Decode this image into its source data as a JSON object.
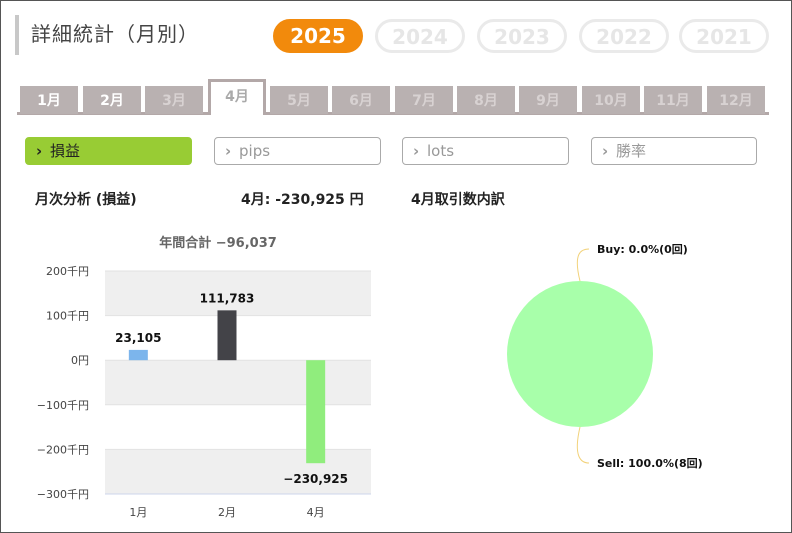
{
  "page": {
    "title": "詳細統計（月別）"
  },
  "years": [
    {
      "label": "2025",
      "active": true
    },
    {
      "label": "2024",
      "active": false
    },
    {
      "label": "2023",
      "active": false
    },
    {
      "label": "2022",
      "active": false
    },
    {
      "label": "2021",
      "active": false
    }
  ],
  "months": [
    {
      "label": "1月",
      "state": "enabled"
    },
    {
      "label": "2月",
      "state": "enabled"
    },
    {
      "label": "3月",
      "state": "disabled"
    },
    {
      "label": "4月",
      "state": "active"
    },
    {
      "label": "5月",
      "state": "disabled"
    },
    {
      "label": "6月",
      "state": "disabled"
    },
    {
      "label": "7月",
      "state": "disabled"
    },
    {
      "label": "8月",
      "state": "disabled"
    },
    {
      "label": "9月",
      "state": "disabled"
    },
    {
      "label": "10月",
      "state": "disabled"
    },
    {
      "label": "11月",
      "state": "disabled"
    },
    {
      "label": "12月",
      "state": "disabled"
    }
  ],
  "metrics": [
    {
      "label": "損益",
      "active": true
    },
    {
      "label": "pips",
      "active": false
    },
    {
      "label": "lots",
      "active": false
    },
    {
      "label": "勝率",
      "active": false
    }
  ],
  "headers": {
    "analysis": "月次分析 (損益)",
    "month_value": "4月:  -230,925 円",
    "breakdown": "4月取引数内訳"
  },
  "chart_data": [
    {
      "type": "bar",
      "title": "年間合計 −96,037",
      "categories": [
        "1月",
        "2月",
        "4月"
      ],
      "values": [
        23105,
        111783,
        -230925
      ],
      "value_labels": [
        "23,105",
        "111,783",
        "−230,925"
      ],
      "colors": [
        "#7cb5ec",
        "#434348",
        "#90ed7d"
      ],
      "ylim": [
        -300000,
        200000
      ],
      "yticks": [
        200000,
        100000,
        0,
        -100000,
        -200000,
        -300000
      ],
      "ytick_labels": [
        "200千円",
        "100千円",
        "0円",
        "−100千円",
        "−200千円",
        "−300千円"
      ],
      "grid": "alternating bands",
      "legend": "none"
    },
    {
      "type": "pie",
      "slices": [
        {
          "name": "Buy",
          "percent": 0.0,
          "count": 0,
          "label": "Buy: 0.0%(0回)",
          "color": "#7cb5ec"
        },
        {
          "name": "Sell",
          "percent": 100.0,
          "count": 8,
          "label": "Sell: 100.0%(8回)",
          "color": "#a8ffaa"
        }
      ],
      "connector_color": "#f2d27a"
    }
  ]
}
